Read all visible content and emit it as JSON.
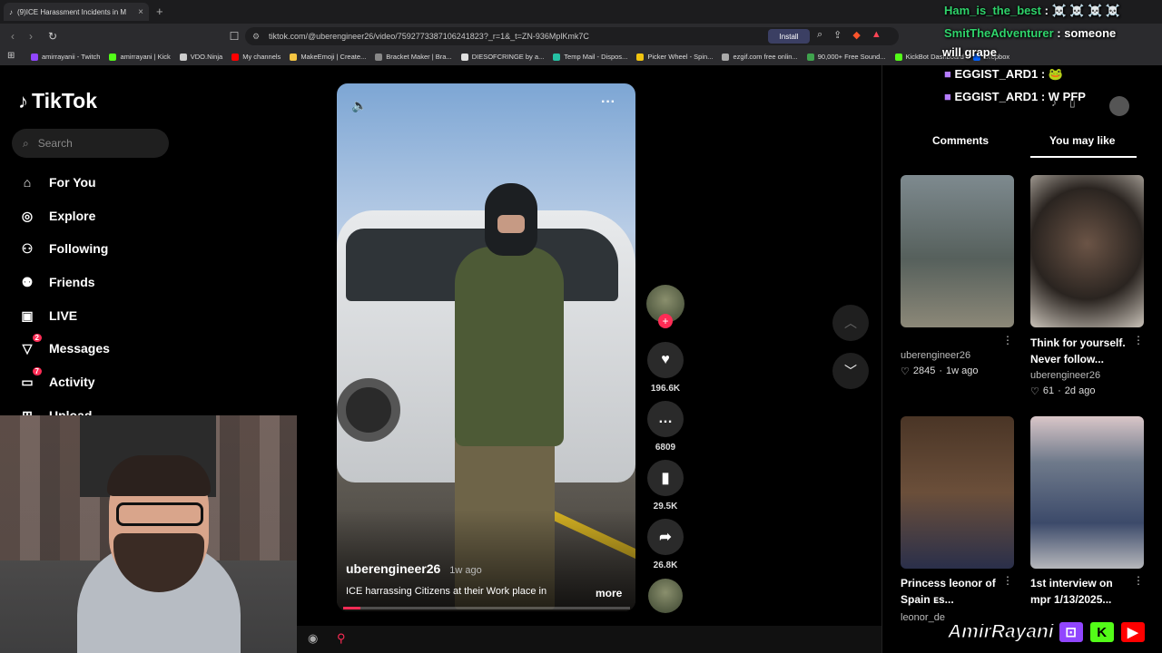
{
  "browser": {
    "tab_title": "(9)ICE Harassment Incidents in M",
    "new_tab": "+",
    "url": "tiktok.com/@uberengineer26/video/7592773387106241823?_r=1&_t=ZN-936MplKmk7C",
    "install_label": "Install",
    "bookmarks": [
      {
        "label": "amirrayanii - Twitch",
        "color": "#9146ff"
      },
      {
        "label": "amirrayani | Kick",
        "color": "#53fc18"
      },
      {
        "label": "VDO.Ninja",
        "color": "#cccccc"
      },
      {
        "label": "My channels",
        "color": "#ff0000"
      },
      {
        "label": "MakeEmoji | Create...",
        "color": "#f5c542"
      },
      {
        "label": "Bracket Maker | Bra...",
        "color": "#888888"
      },
      {
        "label": "DIESOFCRINGE by a...",
        "color": "#e0e0e0"
      },
      {
        "label": "Temp Mail - Dispos...",
        "color": "#25c1a4"
      },
      {
        "label": "Picker Wheel - Spin...",
        "color": "#f1c40f"
      },
      {
        "label": "ezgif.com free onlin...",
        "color": "#aaaaaa"
      },
      {
        "label": "90,000+ Free Sound...",
        "color": "#3fa34d"
      },
      {
        "label": "KickBot Dashboard",
        "color": "#53fc18"
      },
      {
        "label": "Dropbox",
        "color": "#0061ff"
      }
    ]
  },
  "sidebar": {
    "logo": "TikTok",
    "search_placeholder": "Search",
    "items": [
      {
        "label": "For You",
        "icon": "home-icon"
      },
      {
        "label": "Explore",
        "icon": "compass-icon"
      },
      {
        "label": "Following",
        "icon": "following-icon"
      },
      {
        "label": "Friends",
        "icon": "friends-icon"
      },
      {
        "label": "LIVE",
        "icon": "live-icon"
      },
      {
        "label": "Messages",
        "icon": "messages-icon",
        "badge": "2"
      },
      {
        "label": "Activity",
        "icon": "activity-icon",
        "badge": "7"
      },
      {
        "label": "Upload",
        "icon": "upload-icon"
      }
    ]
  },
  "video": {
    "author": "uberengineer26",
    "ago": "1w ago",
    "caption": "ICE harrassing Citizens at their Work place in",
    "more_label": "more",
    "progress": 0.06,
    "likes": "196.6K",
    "comments": "6809",
    "saves": "29.5K",
    "shares": "26.8K",
    "follow_plus": "+"
  },
  "right_panel": {
    "tab_comments": "Comments",
    "tab_you_may_like": "You may like",
    "cards": [
      {
        "caption": "",
        "user": "uberengineer26",
        "likes": "2845",
        "ago": "1w ago"
      },
      {
        "caption": "Think for yourself. Never follow...",
        "user": "uberengineer26",
        "likes": "61",
        "ago": "2d ago"
      },
      {
        "caption": "Princess leonor of Spain ᴇs...",
        "user": "leonor_de",
        "likes": "",
        "ago": ""
      },
      {
        "caption": "1st interview on mpr 1/13/2025...",
        "user": "",
        "likes": "",
        "ago": ""
      }
    ]
  },
  "chat": [
    {
      "user": "Ham_is_the_best",
      "msg": " : ☠️ ☠️ ☠️ ☠️"
    },
    {
      "user": "SmitTheAdventurer",
      "msg": " : someone"
    },
    {
      "user": "",
      "msg": "will grape"
    },
    {
      "user": "EGGIST_ARD1",
      "msg": " : 🐸"
    },
    {
      "user": "EGGIST_ARD1",
      "msg": " : W PFP"
    }
  ],
  "branding": {
    "name": "AmirRayani",
    "colors": {
      "twitch": "#9146ff",
      "kick": "#53fc18",
      "youtube": "#ff0000"
    }
  },
  "colors": {
    "accent": "#fe2c55"
  }
}
